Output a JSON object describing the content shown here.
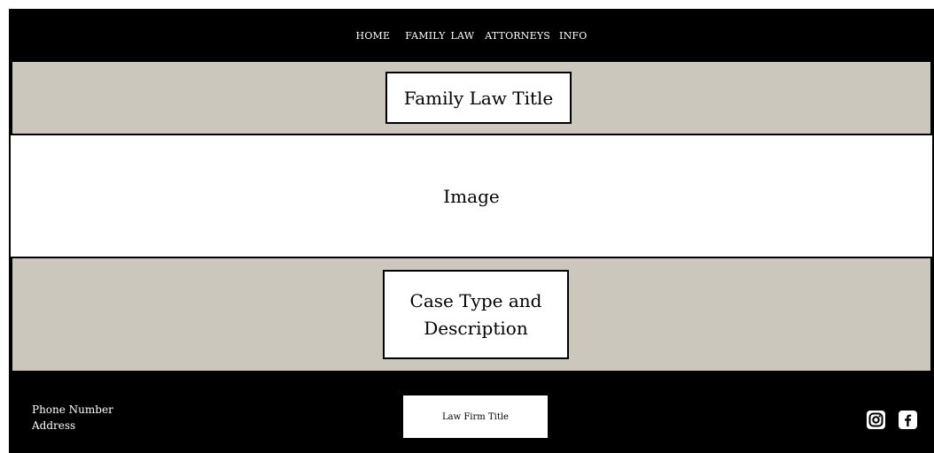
{
  "nav": {
    "items": [
      {
        "label": "HOME"
      },
      {
        "label": "FAMILY"
      },
      {
        "label": "LAW"
      },
      {
        "label": "ATTORNEYS"
      },
      {
        "label": "INFO"
      }
    ]
  },
  "hero": {
    "title": "Family Law Title"
  },
  "image_section": {
    "label": "Image"
  },
  "case_section": {
    "text": "Case Type and Description"
  },
  "footer": {
    "phone": "Phone Number",
    "address": "Address",
    "firm_title": "Law Firm Title",
    "social_icons": [
      "instagram-icon",
      "facebook-icon"
    ]
  },
  "colors": {
    "nav_bg": "#000000",
    "band_bg": "#cbc7bc",
    "footer_bg": "#000000",
    "text_light": "#ffffff",
    "text_dark": "#000000"
  }
}
